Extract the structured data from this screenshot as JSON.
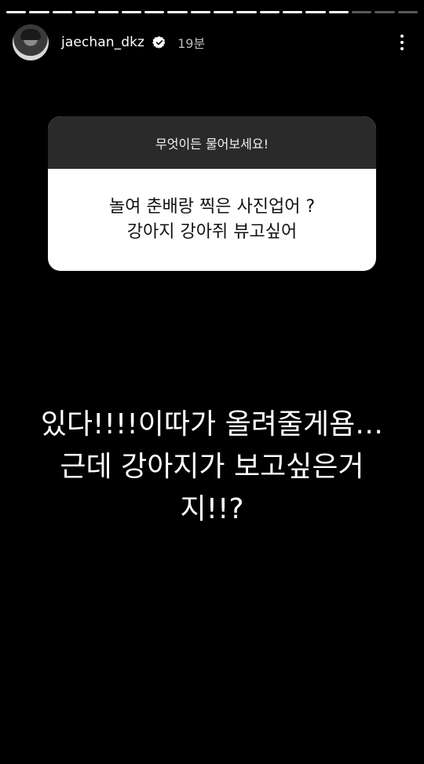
{
  "story": {
    "progress_segments_total": 18,
    "progress_segments_filled": 15
  },
  "header": {
    "username": "jaechan_dkz",
    "time": "19분",
    "verified_icon": "verified-badge-icon",
    "more_icon": "more-vertical-icon"
  },
  "question_card": {
    "prompt": "무엇이든 물어보세요!",
    "question_lines": [
      "놀여 춘배랑 찍은 사진업어 ?",
      "강아지 강아쥐 뷰고싶어"
    ]
  },
  "answer": {
    "lines": [
      "있다!!!!이따가 올려줄게욤…",
      "근데 강아지가 보고싶은거",
      "지!!?"
    ]
  },
  "colors": {
    "background": "#000000",
    "card_header": "#2a2a2a",
    "card_body": "#ffffff"
  }
}
